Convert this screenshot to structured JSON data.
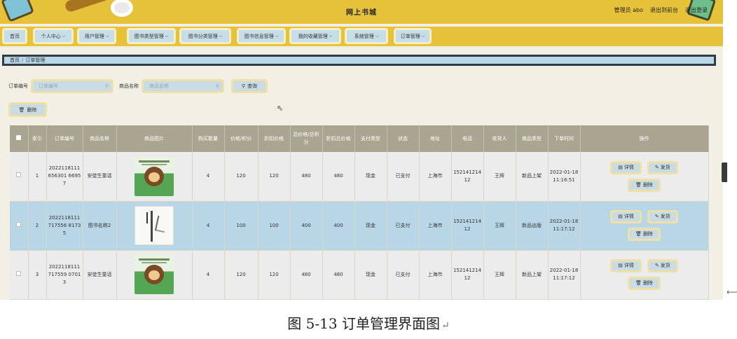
{
  "header": {
    "title": "网上书城",
    "user": "管理员 abo",
    "back_to_front": "退出到前台",
    "logout": "退出登录"
  },
  "nav": [
    {
      "label": "首页",
      "dropdown": false
    },
    {
      "label": "个人中心",
      "dropdown": true
    },
    {
      "label": "用户管理",
      "dropdown": true
    },
    {
      "label": "图书类型管理",
      "dropdown": true
    },
    {
      "label": "图书分类管理",
      "dropdown": true
    },
    {
      "label": "图书信息管理",
      "dropdown": true
    },
    {
      "label": "我的收藏管理",
      "dropdown": true
    },
    {
      "label": "系统管理",
      "dropdown": true
    },
    {
      "label": "订单管理",
      "dropdown": true
    }
  ],
  "breadcrumb": {
    "home": "首页",
    "separator": "/",
    "current": "订单管理"
  },
  "search": {
    "order_label": "订单编号",
    "order_placeholder": "订单编号",
    "product_label": "商品名称",
    "product_placeholder": "商品名称",
    "query_button": "查询",
    "delete_button": "删除"
  },
  "table": {
    "headers": [
      "",
      "索引",
      "订单编号",
      "商品名称",
      "商品图片",
      "购买数量",
      "价格/积分",
      "折扣价格",
      "总价格/总积分",
      "折扣总价格",
      "支付类型",
      "状态",
      "地址",
      "电话",
      "收货人",
      "商品类型",
      "下单时间",
      "操作"
    ],
    "rows": [
      {
        "index": "1",
        "order_no": "2022118111656301 66957",
        "product": "安徒生童话",
        "image": "cartoon",
        "qty": "4",
        "price": "120",
        "discount_price": "120",
        "total": "480",
        "discount_total": "480",
        "pay_type": "现金",
        "status": "已支付",
        "address": "上海市",
        "phone": "15214121412",
        "receiver": "王辉",
        "type": "新品上架",
        "time": "2022-01-18 11:16:51"
      },
      {
        "index": "2",
        "order_no": "2022118111717556 81735",
        "product": "图书名称2",
        "image": "book",
        "qty": "4",
        "price": "100",
        "discount_price": "100",
        "total": "400",
        "discount_total": "400",
        "pay_type": "现金",
        "status": "已支付",
        "address": "上海市",
        "phone": "15214121412",
        "receiver": "王辉",
        "type": "新品出版",
        "time": "2022-01-18 11:17:12"
      },
      {
        "index": "3",
        "order_no": "2022118111717559 07013",
        "product": "安徒生童话",
        "image": "cartoon",
        "qty": "4",
        "price": "120",
        "discount_price": "120",
        "total": "480",
        "discount_total": "480",
        "pay_type": "现金",
        "status": "已支付",
        "address": "上海市",
        "phone": "15214121412",
        "receiver": "王辉",
        "type": "新品上架",
        "time": "2022-01-18 11:17:12"
      }
    ],
    "ops": {
      "detail": "详情",
      "ship": "发货",
      "delete": "删除"
    }
  },
  "caption": "图 5-13 订单管理界面图",
  "colors": {
    "header_bg": "#e6c13a",
    "page_bg": "#f2f0e4",
    "button_bg": "#c9dce6",
    "button_border": "#efe1a6",
    "table_head": "#aaa591",
    "selected_row": "#b8d6e6"
  },
  "icons": {
    "search": "search-icon",
    "trash": "trash-icon",
    "detail": "document-icon",
    "ship": "edit-icon",
    "cursor": "mouse-cursor-icon"
  }
}
